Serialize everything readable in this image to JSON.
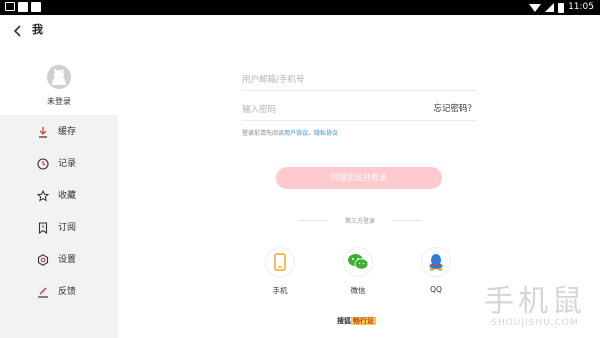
{
  "status_bar": {
    "time": "11:05"
  },
  "header": {
    "title": "我"
  },
  "profile": {
    "name": "未登录"
  },
  "sidebar": {
    "items": [
      {
        "label": "缓存",
        "icon": "download-icon"
      },
      {
        "label": "记录",
        "icon": "clock-icon"
      },
      {
        "label": "收藏",
        "icon": "star-icon"
      },
      {
        "label": "订阅",
        "icon": "bookmark-icon"
      },
      {
        "label": "设置",
        "icon": "gear-icon"
      },
      {
        "label": "反馈",
        "icon": "pencil-icon"
      }
    ]
  },
  "login": {
    "account_placeholder": "用户邮箱/手机号",
    "password_placeholder": "输入密码",
    "forgot_password": "忘记密码？",
    "agreement_prefix": "登录前请先阅读",
    "user_agreement": "用户协议",
    "separator": "、",
    "privacy_agreement": "隐私协议",
    "submit_label": "同意协议并登录",
    "third_party_label": "第三方登录"
  },
  "social": [
    {
      "label": "手机",
      "icon": "phone-icon"
    },
    {
      "label": "微信",
      "icon": "wechat-icon"
    },
    {
      "label": "QQ",
      "icon": "qq-icon"
    }
  ],
  "footer": {
    "brand_prefix": "搜狐",
    "brand_highlight": "畅行证"
  },
  "watermark": {
    "cn": "手机鼠",
    "en": "SHOUJISHU.COM"
  },
  "colors": {
    "accent_pink": "#ffc9d0",
    "link_blue": "#2d8cf0",
    "sidebar_bg": "#f2f2f2",
    "phone_orange": "#f5a623",
    "wechat_green": "#3cb034",
    "qq_blue": "#2b7fd8"
  }
}
